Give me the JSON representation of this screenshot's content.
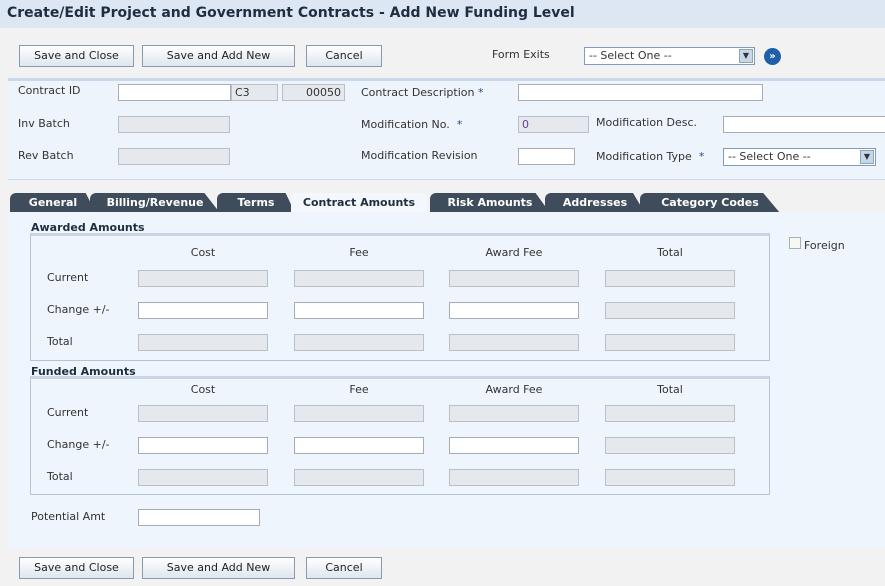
{
  "title": "Create/Edit Project and Government Contracts - Add New Funding Level",
  "toolbar": {
    "save_close": "Save and Close",
    "save_add": "Save and Add New",
    "cancel": "Cancel",
    "form_exits_label": "Form Exits",
    "form_exits_value": "-- Select One --"
  },
  "header": {
    "contract_id_label": "Contract ID",
    "contract_id": "",
    "contract_type": "C3",
    "company": "00050",
    "contract_desc_label": "Contract Description",
    "contract_desc": "",
    "inv_batch_label": "Inv Batch",
    "rev_batch_label": "Rev Batch",
    "mod_no_label": "Modification No.",
    "mod_no": "0",
    "mod_rev_label": "Modification Revision",
    "mod_desc_label": "Modification Desc.",
    "mod_type_label": "Modification Type",
    "mod_type_value": "-- Select One --",
    "required": "*"
  },
  "tabs": [
    "General",
    "Billing/Revenue",
    "Terms",
    "Contract Amounts",
    "Risk Amounts",
    "Addresses",
    "Category Codes"
  ],
  "awarded": {
    "title": "Awarded Amounts",
    "columns": [
      "Cost",
      "Fee",
      "Award Fee",
      "Total"
    ],
    "rows": [
      "Current",
      "Change +/-",
      "Total"
    ]
  },
  "funded": {
    "title": "Funded Amounts",
    "columns": [
      "Cost",
      "Fee",
      "Award Fee",
      "Total"
    ],
    "rows": [
      "Current",
      "Change +/-",
      "Total"
    ]
  },
  "foreign_label": "Foreign",
  "potential_amt_label": "Potential Amt",
  "footer": {
    "save_close": "Save and Close",
    "save_add": "Save and Add New",
    "cancel": "Cancel"
  }
}
